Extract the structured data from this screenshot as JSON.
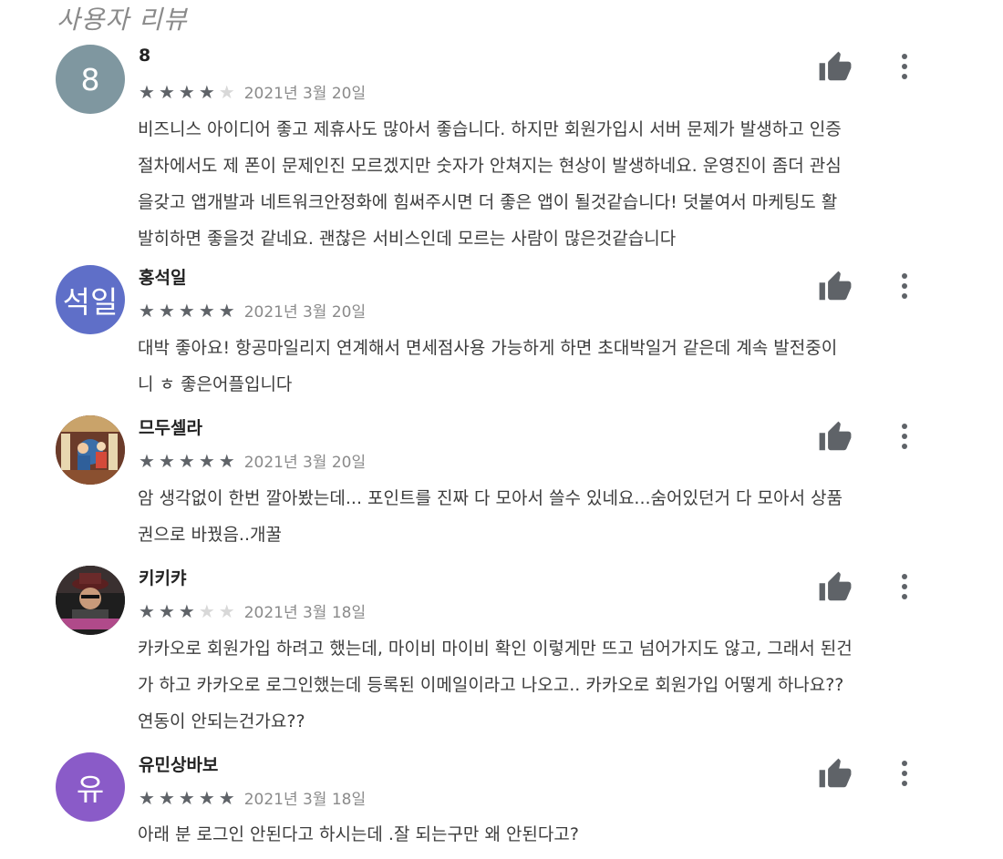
{
  "section_title": "사용자 리뷰",
  "colors": {
    "star_on": "#5f6368",
    "star_off": "#d8d8d8",
    "text": "#3c3c3c",
    "meta": "#8a8a8a"
  },
  "reviews": [
    {
      "avatar_text": "8",
      "avatar_color": "#7f97a0",
      "avatar_type": "letter",
      "name": "8",
      "rating": 4,
      "date": "2021년 3월 20일",
      "text": "비즈니스 아이디어 좋고 제휴사도 많아서 좋습니다. 하지만 회원가입시 서버 문제가 발생하고 인증\n절차에서도 제 폰이 문제인진 모르겠지만 숫자가 안쳐지는 현상이 발생하네요. 운영진이 좀더 관심\n을갖고 앱개발과 네트워크안정화에 힘써주시면 더 좋은 앱이 될것같습니다! 덧붙여서 마케팅도 활\n발히하면 좋을것 같네요. 괜찮은 서비스인데 모르는 사람이 많은것같습니다"
    },
    {
      "avatar_text": "석일",
      "avatar_color": "#5f6fc8",
      "avatar_type": "letter",
      "name": "홍석일",
      "rating": 5,
      "date": "2021년 3월 20일",
      "text": "대박 좋아요! 항공마일리지 연계해서 면세점사용 가능하게 하면 초대박일거 같은데 계속 발전중이\n니 ㅎ 좋은어플입니다"
    },
    {
      "avatar_text": "",
      "avatar_color": "#8b5a3c",
      "avatar_type": "photo-carousel",
      "name": "므두셀라",
      "rating": 5,
      "date": "2021년 3월 20일",
      "text": "암 생각없이 한번 깔아봤는데... 포인트를 진짜 다 모아서 쓸수 있네요...숨어있던거 다 모아서 상품\n권으로 바꿨음..개꿀"
    },
    {
      "avatar_text": "",
      "avatar_color": "#2a2a2a",
      "avatar_type": "photo-person",
      "name": "키키캬",
      "rating": 3,
      "date": "2021년 3월 18일",
      "text": "카카오로 회원가입 하려고 했는데, 마이비 마이비 확인 이렇게만 뜨고 넘어가지도 않고, 그래서 된건\n가 하고 카카오로 로그인했는데 등록된 이메일이라고 나오고.. 카카오로 회원가입 어떻게 하나요??\n연동이 안되는건가요??"
    },
    {
      "avatar_text": "유",
      "avatar_color": "#8a5bc8",
      "avatar_type": "letter",
      "name": "유민상바보",
      "rating": 5,
      "date": "2021년 3월 18일",
      "text": "아래 분 로그인 안된다고 하시는데 .잘 되는구만 왜 안된다고?"
    }
  ]
}
